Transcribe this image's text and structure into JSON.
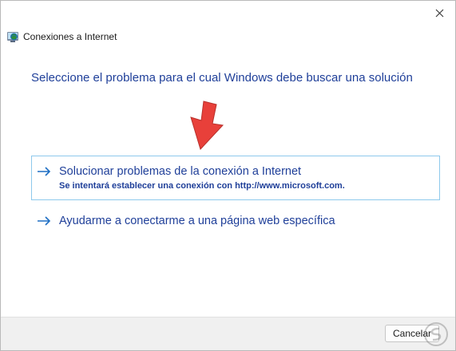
{
  "window": {
    "title": "Conexiones a Internet",
    "title_icon": "network-globe-icon"
  },
  "controls": {
    "close_icon": "close-icon"
  },
  "main": {
    "heading": "Seleccione el problema para el cual Windows debe buscar una solución",
    "options": [
      {
        "label": "Solucionar problemas de la conexión a Internet",
        "description": "Se intentará establecer una conexión con http://www.microsoft.com.",
        "icon": "arrow-right-icon",
        "highlighted": true
      },
      {
        "label": "Ayudarme a conectarme a una página web específica",
        "icon": "arrow-right-icon",
        "highlighted": false
      }
    ]
  },
  "footer": {
    "cancel_label": "Cancelar"
  },
  "colors": {
    "link_blue": "#1f3f99",
    "highlight_border": "#8ec9ec",
    "annotation_red": "#e8403a",
    "footer_bg": "#f0f0f0"
  }
}
